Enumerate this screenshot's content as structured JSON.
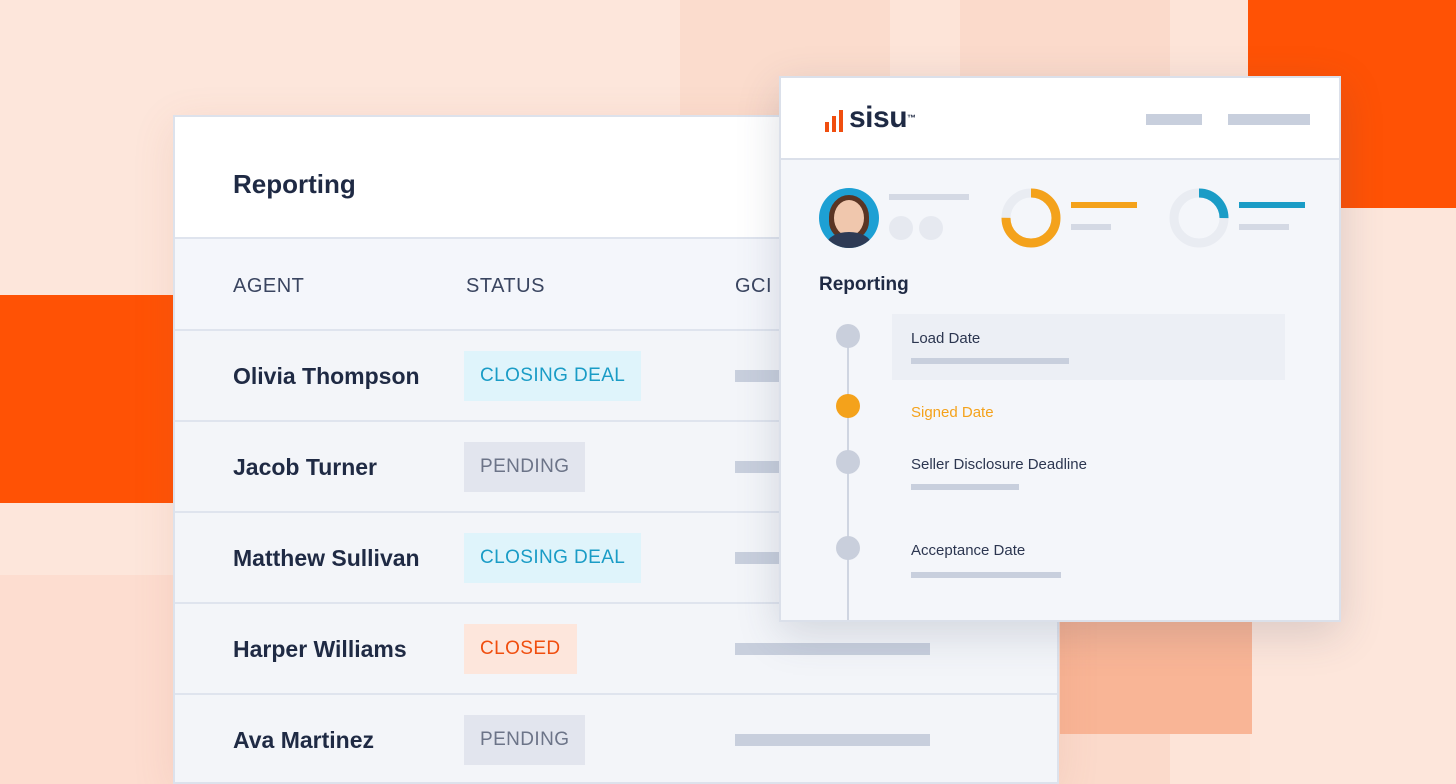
{
  "reporting_table": {
    "title": "Reporting",
    "columns": [
      "AGENT",
      "STATUS",
      "GCI"
    ],
    "rows": [
      {
        "agent": "Olivia Thompson",
        "status": "CLOSING DEAL",
        "status_type": "closing"
      },
      {
        "agent": "Jacob Turner",
        "status": "PENDING",
        "status_type": "pending"
      },
      {
        "agent": "Matthew Sullivan",
        "status": "CLOSING DEAL",
        "status_type": "closing"
      },
      {
        "agent": "Harper Williams",
        "status": "CLOSED",
        "status_type": "closed"
      },
      {
        "agent": "Ava Martinez",
        "status": "PENDING",
        "status_type": "pending"
      }
    ]
  },
  "detail_card": {
    "logo_text": "sisu",
    "logo_mark": "™",
    "section_title": "Reporting",
    "timeline": [
      {
        "label": "Load Date",
        "active": false
      },
      {
        "label": "Signed Date",
        "active": true
      },
      {
        "label": "Seller Disclosure Deadline",
        "active": false
      },
      {
        "label": "Acceptance Date",
        "active": false
      }
    ],
    "donuts": [
      {
        "name": "orange-progress",
        "fraction": 0.75,
        "color": "#f4a21b"
      },
      {
        "name": "blue-progress",
        "fraction": 0.25,
        "color": "#1a9cc6"
      }
    ]
  },
  "colors": {
    "brand_orange": "#ff5205",
    "closing": "#1a9cc6",
    "closed": "#f04e0f",
    "pending": "#6c7488",
    "timeline_active": "#f4a21b"
  }
}
